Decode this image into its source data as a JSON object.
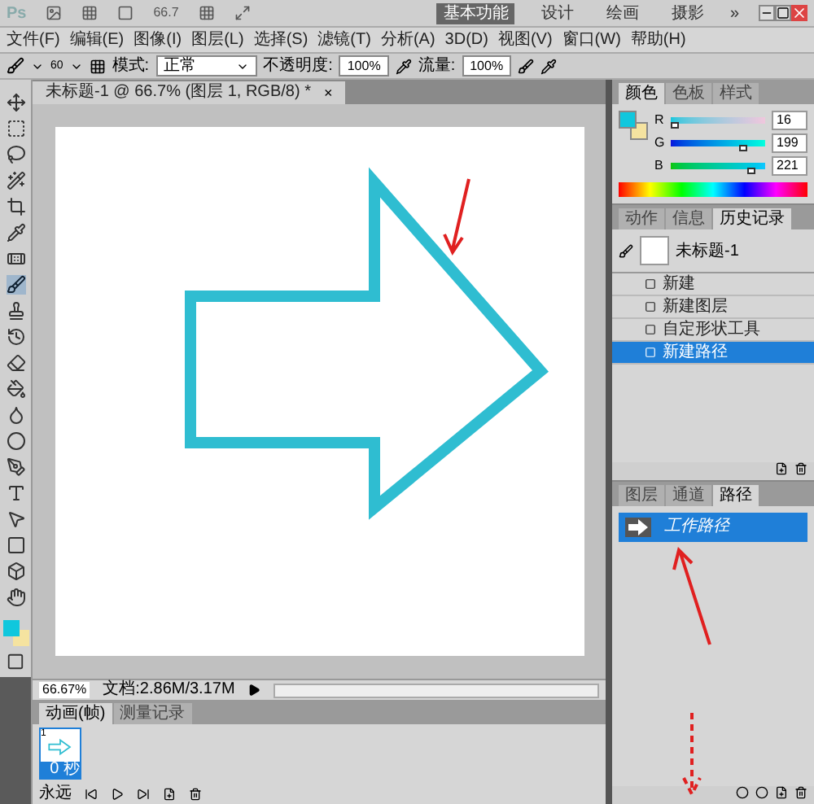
{
  "app_bar": {
    "logo": "Ps",
    "zoom": "66.7",
    "workspaces": [
      {
        "label": "基本功能",
        "selected": true
      },
      {
        "label": "设计",
        "selected": false
      },
      {
        "label": "绘画",
        "selected": false
      },
      {
        "label": "摄影",
        "selected": false
      }
    ],
    "more": "»"
  },
  "menu": [
    "文件(F)",
    "编辑(E)",
    "图像(I)",
    "图层(L)",
    "选择(S)",
    "滤镜(T)",
    "分析(A)",
    "3D(D)",
    "视图(V)",
    "窗口(W)",
    "帮助(H)"
  ],
  "options": {
    "brush_size": "60",
    "mode_label": "模式:",
    "mode": "正常",
    "opacity_label": "不透明度:",
    "opacity": "100%",
    "flow_label": "流量:",
    "flow": "100%"
  },
  "tools": [
    {
      "selected": false
    },
    {
      "selected": false
    },
    {
      "selected": false
    },
    {
      "selected": false
    },
    {
      "selected": false
    },
    {
      "selected": false
    },
    {
      "selected": false
    },
    {
      "selected": true
    },
    {
      "selected": false
    },
    {
      "selected": false
    },
    {
      "selected": false
    },
    {
      "selected": false
    },
    {
      "selected": false
    },
    {
      "selected": false
    },
    {
      "selected": false
    },
    {
      "selected": false
    },
    {
      "selected": false
    },
    {
      "selected": false
    },
    {
      "selected": false
    },
    {
      "selected": false
    }
  ],
  "document": {
    "tab": "未标题-1 @ 66.7% (图层 1, RGB/8) *",
    "close": "×",
    "zoom": "66.67%",
    "doc_size": "文档:2.86M/3.17M"
  },
  "animation": {
    "tabs": [
      {
        "label": "动画(帧)",
        "selected": true
      },
      {
        "label": "测量记录",
        "selected": false
      }
    ],
    "frame_number": "1",
    "frame_delay": "0 秒",
    "loop": "永远"
  },
  "color_panel": {
    "tabs": [
      {
        "label": "颜色",
        "selected": true
      },
      {
        "label": "色板",
        "selected": false
      },
      {
        "label": "样式",
        "selected": false
      }
    ],
    "channels": [
      {
        "name": "R",
        "value": "16",
        "level": 0.06
      },
      {
        "name": "G",
        "value": "199",
        "level": 0.78
      },
      {
        "name": "B",
        "value": "221",
        "level": 0.87
      }
    ]
  },
  "history_panel": {
    "tabs": [
      {
        "label": "动作",
        "selected": false
      },
      {
        "label": "信息",
        "selected": false
      },
      {
        "label": "历史记录",
        "selected": true
      }
    ],
    "snapshot": "未标题-1",
    "items": [
      {
        "label": "新建",
        "selected": false
      },
      {
        "label": "新建图层",
        "selected": false
      },
      {
        "label": "自定形状工具",
        "selected": false
      },
      {
        "label": "新建路径",
        "selected": true
      }
    ]
  },
  "paths_panel": {
    "tabs": [
      {
        "label": "图层",
        "selected": false
      },
      {
        "label": "通道",
        "selected": false
      },
      {
        "label": "路径",
        "selected": true
      }
    ],
    "paths": [
      {
        "label": "工作路径",
        "selected": true
      }
    ]
  }
}
